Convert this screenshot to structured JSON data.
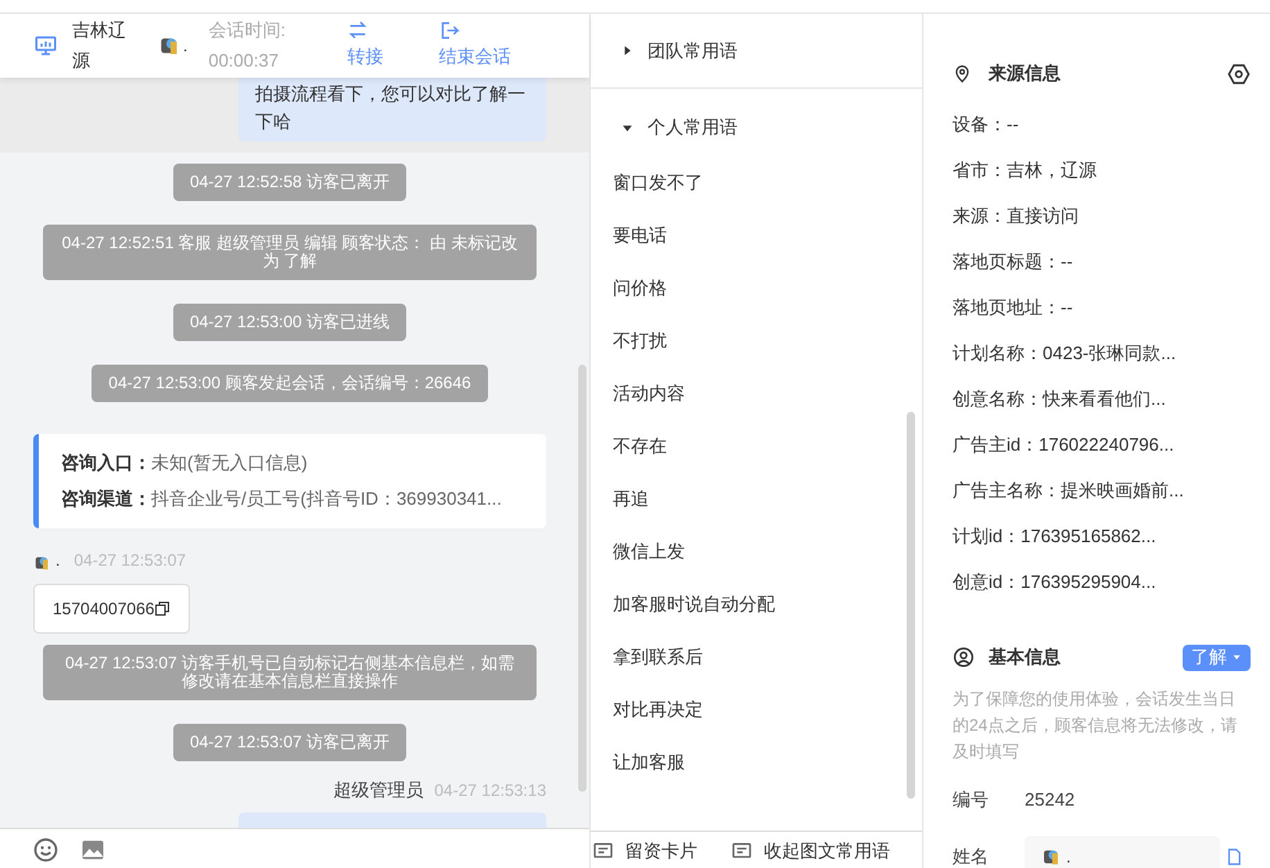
{
  "header": {
    "location": "吉林辽源",
    "visitor_name": ".",
    "session_label": "会话时间:",
    "session_time": "00:00:37",
    "actions": [
      {
        "kind": "transfer",
        "label": "转接"
      },
      {
        "kind": "end",
        "label": "结束会话"
      }
    ]
  },
  "messages": [
    {
      "kind": "agent_bubble_tail",
      "text": "拍摄流程看下，您可以对比了解一下哈"
    },
    {
      "kind": "system",
      "text": "04-27 12:52:58 访客已离开"
    },
    {
      "kind": "system",
      "text": "04-27 12:52:51 客服 超级管理员 编辑 顾客状态： 由 未标记改为 了解"
    },
    {
      "kind": "system",
      "text": "04-27 12:53:00 访客已进线"
    },
    {
      "kind": "system",
      "text": "04-27 12:53:00 顾客发起会话，会话编号：26646"
    },
    {
      "kind": "source_card",
      "rows": [
        {
          "label": "咨询入口：",
          "value": "未知(暂无入口信息)"
        },
        {
          "label": "咨询渠道：",
          "value": "抖音企业号/员工号(抖音号ID：369930341..."
        }
      ]
    },
    {
      "kind": "visitor",
      "name": ".",
      "time": "04-27 12:53:07",
      "text": "15704007066"
    },
    {
      "kind": "system",
      "text": "04-27 12:53:07 访客手机号已自动标记右侧基本信息栏，如需修改请在基本信息栏直接操作"
    },
    {
      "kind": "system",
      "text": "04-27 12:53:07 访客已离开"
    },
    {
      "kind": "agent",
      "name": "超级管理员",
      "time": "04-27 12:53:13"
    }
  ],
  "phrases": {
    "groups": [
      {
        "label": "团队常用语",
        "expanded": false
      },
      {
        "label": "个人常用语",
        "expanded": true
      }
    ],
    "items": [
      "窗口发不了",
      "要电话",
      "问价格",
      "不打扰",
      "活动内容",
      "不存在",
      "再追",
      "微信上发",
      "加客服时说自动分配",
      "拿到联系后",
      "对比再决定",
      "让加客服"
    ],
    "footer": [
      {
        "label": "留资卡片"
      },
      {
        "label": "收起图文常用语"
      }
    ]
  },
  "source_info": {
    "title": "来源信息",
    "rows": [
      "设备：--",
      "省市：吉林，辽源",
      "来源：直接访问",
      "落地页标题：--",
      "落地页地址：--",
      "计划名称：0423-张琳同款...",
      "创意名称：快来看看他们...",
      "广告主id：176022240796...",
      "广告主名称：提米映画婚前...",
      "计划id：176395165862...",
      "创意id：176395295904..."
    ]
  },
  "basic_info": {
    "title": "基本信息",
    "status": "了解",
    "notice": "为了保障您的使用体验，会话发生当日的24点之后，顾客信息将无法修改，请及时填写",
    "fields": [
      {
        "label": "编号",
        "value": "25242",
        "kind": "text"
      },
      {
        "label": "姓名",
        "value": ".",
        "kind": "input"
      }
    ]
  }
}
